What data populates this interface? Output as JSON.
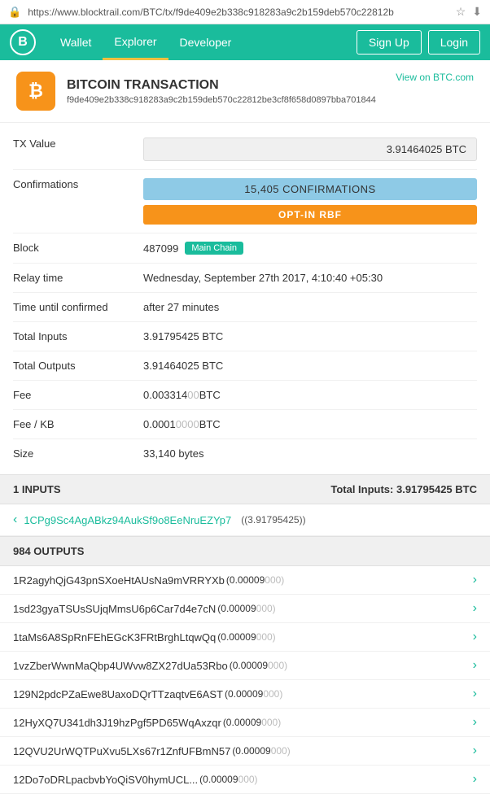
{
  "urlBar": {
    "url": "https://www.blocktrail.com/BTC/tx/f9de409e2b338c918283a9c2b159deb570c22812b",
    "lockIcon": "🔒"
  },
  "nav": {
    "logo": "B",
    "items": [
      {
        "label": "Wallet",
        "active": false
      },
      {
        "label": "Explorer",
        "active": true
      },
      {
        "label": "Developer",
        "active": false
      }
    ],
    "rightItems": [
      {
        "label": "Sign Up"
      },
      {
        "label": "Login"
      }
    ]
  },
  "transaction": {
    "title": "BITCOIN TRANSACTION",
    "viewOnBtcLabel": "View on BTC.com",
    "hash": "f9de409e2b338c918283a9c2b159deb570c22812be3cf8f658d0897bba701844",
    "btcLogoChar": "₿",
    "fields": {
      "txValueLabel": "TX Value",
      "txValue": "3.91464025 BTC",
      "confirmationsLabel": "Confirmations",
      "confirmationsValue": "15,405 CONFIRMATIONS",
      "rbfLabel": "OPT-IN RBF",
      "blockLabel": "Block",
      "blockNumber": "487099",
      "mainChainLabel": "Main Chain",
      "relayTimeLabel": "Relay time",
      "relayTime": "Wednesday, September 27th 2017, 4:10:40 +05:30",
      "timeUntilConfirmedLabel": "Time until confirmed",
      "timeUntilConfirmed": "after 27 minutes",
      "totalInputsLabel": "Total Inputs",
      "totalInputs": "3.91795425 BTC",
      "totalOutputsLabel": "Total Outputs",
      "totalOutputs": "3.91464025 BTC",
      "feeLabel": "Fee",
      "feeMain": "0.003314",
      "feeMuted": "00",
      "feeSuffix": " BTC",
      "feeKbLabel": "Fee / KB",
      "feeKbMain": "0.0001",
      "feeKbMuted": "0000",
      "feeKbSuffix": " BTC",
      "sizeLabel": "Size",
      "size": "33,140 bytes"
    }
  },
  "inputs": {
    "sectionLabel": "1 INPUTS",
    "totalLabel": "Total Inputs: 3.91795425 BTC",
    "items": [
      {
        "address": "1CPg9Sc4AgABkz94AukSf9o8EeNruEZYp7",
        "amount": "(3.91795425)"
      }
    ]
  },
  "outputs": {
    "sectionLabel": "984 OUTPUTS",
    "items": [
      {
        "address": "1R2agyhQjG43pnSXoeHtAUsNa9mVRRYXb",
        "amountMain": "(0.00009",
        "amountMuted": "000)"
      },
      {
        "address": "1sd23gyaTSUsSUjqMmsU6p6Car7d4e7cN",
        "amountMain": "(0.00009",
        "amountMuted": "000)"
      },
      {
        "address": "1taMs6A8SpRnFEhEGcK3FRtBrghLtqwQq",
        "amountMain": "(0.00009",
        "amountMuted": "000)"
      },
      {
        "address": "1vzZberWwnMaQbp4UWvw8ZX27dUa53Rbo",
        "amountMain": "(0.00009",
        "amountMuted": "000)"
      },
      {
        "address": "129N2pdcPZaEwe8UaxoDQrTTzaqtvE6AST",
        "amountMain": "(0.00009",
        "amountMuted": "000)"
      },
      {
        "address": "12HyXQ7U341dh3J19hzPgf5PD65WqAxzqr",
        "amountMain": "(0.00009",
        "amountMuted": "000)"
      },
      {
        "address": "12QVU2UrWQTPuXvu5LXs67r1ZnfUFBmN57",
        "amountMain": "(0.00009",
        "amountMuted": "000)"
      },
      {
        "address": "12Do7oDRLpacbvbYoQiSV0hymUCL...",
        "amountMain": "(0.00009",
        "amountMuted": "000)"
      }
    ]
  }
}
